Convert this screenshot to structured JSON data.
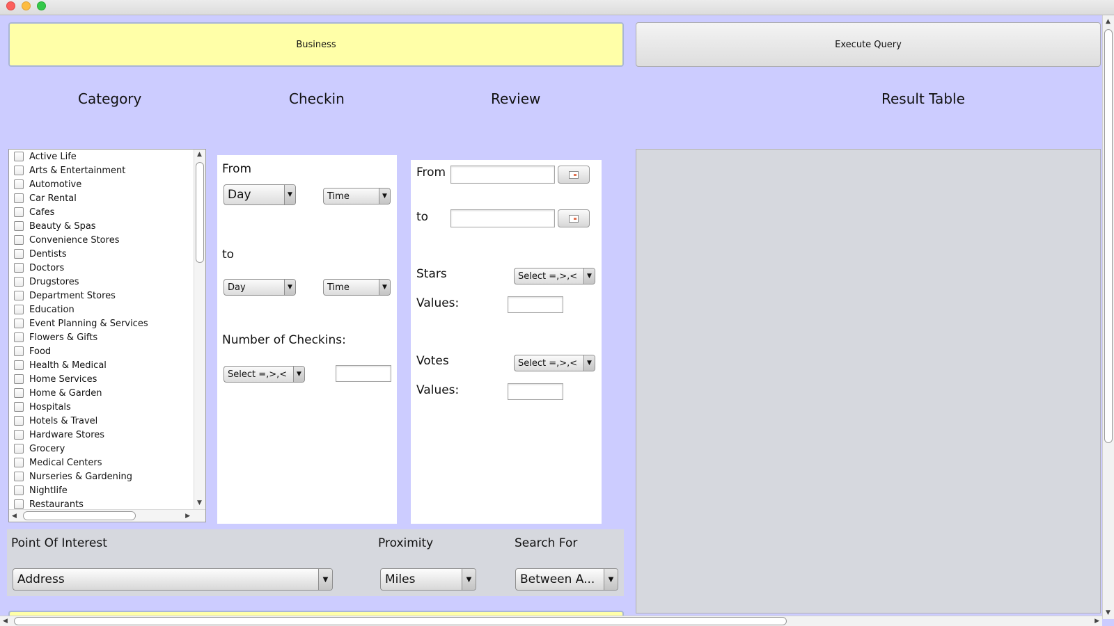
{
  "buttons": {
    "business": "Business",
    "execute": "Execute Query"
  },
  "sections": {
    "category": "Category",
    "checkin": "Checkin",
    "review": "Review",
    "result": "Result Table"
  },
  "categories": [
    "Active Life",
    "Arts & Entertainment",
    "Automotive",
    "Car Rental",
    "Cafes",
    "Beauty & Spas",
    "Convenience Stores",
    "Dentists",
    "Doctors",
    "Drugstores",
    "Department Stores",
    "Education",
    "Event Planning & Services",
    "Flowers & Gifts",
    "Food",
    "Health & Medical",
    "Home Services",
    "Home & Garden",
    "Hospitals",
    "Hotels & Travel",
    "Hardware Stores",
    "Grocery",
    "Medical Centers",
    "Nurseries & Gardening",
    "Nightlife",
    "Restaurants"
  ],
  "checkin": {
    "from_label": "From",
    "to_label": "to",
    "from_day": "Day",
    "from_time": "Time",
    "to_day": "Day",
    "to_time": "Time",
    "count_label": "Number of Checkins:",
    "count_operator": "Select =,>,<"
  },
  "review": {
    "from_label": "From",
    "to_label": "to",
    "stars_label": "Stars",
    "stars_operator": "Select =,>,<",
    "values_label": "Values:",
    "votes_label": "Votes",
    "votes_operator": "Select =,>,<",
    "votes_values_label": "Values:"
  },
  "poi": {
    "poi_label": "Point Of Interest",
    "poi_value": "Address",
    "proximity_label": "Proximity",
    "proximity_value": "Miles",
    "search_label": "Search For",
    "search_value": "Between A..."
  },
  "icons": [
    "calendar-icon",
    "chevron-down-icon",
    "scroll-up-icon",
    "scroll-down-icon"
  ]
}
